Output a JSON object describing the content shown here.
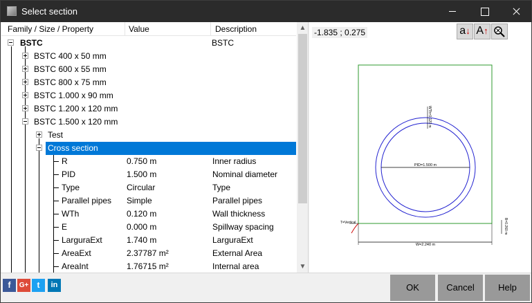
{
  "window": {
    "title": "Select section",
    "minimize_label": "",
    "maximize_label": "",
    "close_label": ""
  },
  "tree": {
    "columns": [
      "Family / Size / Property",
      "Value",
      "Description"
    ],
    "root": {
      "name": "BSTC",
      "description": "BSTC"
    },
    "sizes": [
      "BSTC 400 x 50 mm",
      "BSTC 600 x 55 mm",
      "BSTC 800 x 75 mm",
      "BSTC 1.000 x 90 mm",
      "BSTC 1.200 x 120 mm",
      "BSTC 1.500 x 120 mm"
    ],
    "children": [
      "Test",
      "Cross section"
    ],
    "properties": [
      {
        "name": "R",
        "value": "0.750 m",
        "description": "Inner radius"
      },
      {
        "name": "PID",
        "value": "1.500 m",
        "description": "Nominal diameter"
      },
      {
        "name": "Type",
        "value": "Circular",
        "description": "Type"
      },
      {
        "name": "Parallel pipes",
        "value": "Simple",
        "description": "Parallel pipes"
      },
      {
        "name": "WTh",
        "value": "0.120 m",
        "description": "Wall thickness"
      },
      {
        "name": "E",
        "value": "0.000 m",
        "description": "Spillway spacing"
      },
      {
        "name": "LarguraExt",
        "value": "1.740 m",
        "description": "LarguraExt"
      },
      {
        "name": "AreaExt",
        "value": "2.37787 m²",
        "description": "External Area"
      },
      {
        "name": "AreaInt",
        "value": "1.76715 m²",
        "description": "Internal area"
      }
    ]
  },
  "preview": {
    "coords": "-1.835 ; 0.275",
    "tools": [
      "a↓",
      "A↑",
      "zoom"
    ],
    "drawing": {
      "pid_label": "PID=1.500 m",
      "w_label": "W=2.240 m",
      "wth_label": "WTh=0.120 m",
      "t_label": "T=Vertical",
      "b_label": "B=0.260 m"
    },
    "colors": {
      "frame": "#2e9a2e",
      "pipe": "#2020d0",
      "dim": "#000000",
      "angle": "#d01010"
    }
  },
  "footer": {
    "social": [
      "f",
      "G+",
      "t",
      "in"
    ],
    "ok": "OK",
    "cancel": "Cancel",
    "help": "Help"
  }
}
